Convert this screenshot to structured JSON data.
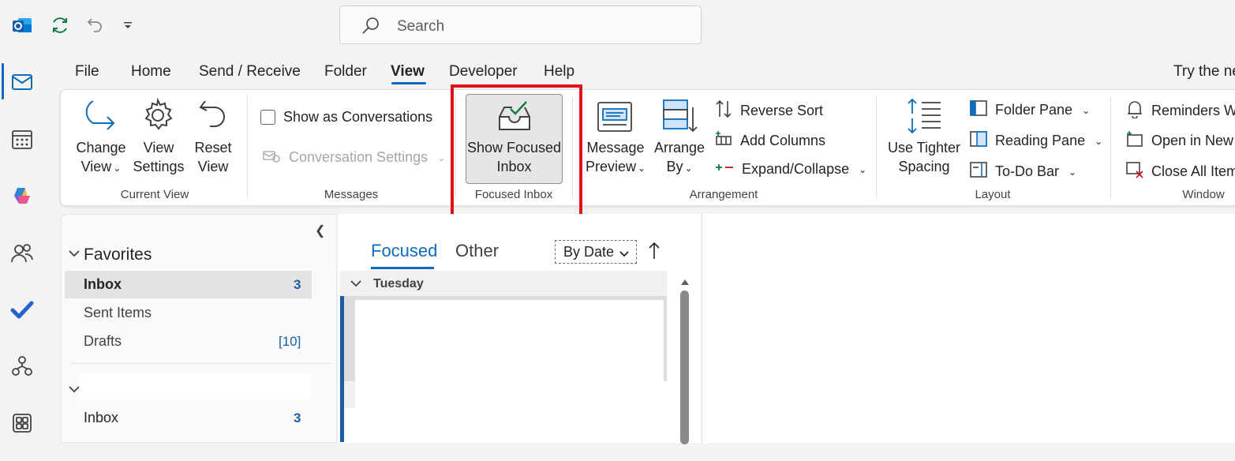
{
  "search": {
    "placeholder": "Search"
  },
  "menu": {
    "tabs": [
      "File",
      "Home",
      "Send / Receive",
      "Folder",
      "View",
      "Developer",
      "Help"
    ],
    "active_tab": "View",
    "promo": "Try the ne"
  },
  "ribbon": {
    "current_view": {
      "group_label": "Current View",
      "change_view": [
        "Change",
        "View"
      ],
      "view_settings": [
        "View",
        "Settings"
      ],
      "reset_view": [
        "Reset",
        "View"
      ]
    },
    "messages": {
      "group_label": "Messages",
      "show_as_conversations": "Show as Conversations",
      "conversation_settings": "Conversation Settings"
    },
    "focused_inbox": {
      "group_label": "Focused Inbox",
      "show_focused_inbox": [
        "Show Focused",
        "Inbox"
      ]
    },
    "arrangement": {
      "group_label": "Arrangement",
      "message_preview": [
        "Message",
        "Preview"
      ],
      "arrange_by": [
        "Arrange",
        "By"
      ],
      "reverse_sort": "Reverse Sort",
      "add_columns": "Add Columns",
      "expand_collapse": "Expand/Collapse"
    },
    "layout": {
      "group_label": "Layout",
      "use_tighter_spacing": [
        "Use Tighter",
        "Spacing"
      ],
      "folder_pane": "Folder Pane",
      "reading_pane": "Reading Pane",
      "todo_bar": "To-Do Bar"
    },
    "window": {
      "group_label": "Window",
      "reminders": "Reminders Wi",
      "open_in_new": "Open in New W",
      "close_all_items": "Close All Item"
    }
  },
  "folders": {
    "favorites_label": "Favorites",
    "favorites": [
      {
        "name": "Inbox",
        "count": "3"
      },
      {
        "name": "Sent Items",
        "count": ""
      },
      {
        "name": "Drafts",
        "count": "[10]"
      }
    ],
    "account_inbox": {
      "name": "Inbox",
      "count": "3"
    }
  },
  "message_list": {
    "tabs": [
      "Focused",
      "Other"
    ],
    "sort": "By Date",
    "day_group": "Tuesday"
  },
  "colors": {
    "accent": "#0f6cbd",
    "highlight": "#e3101a",
    "count": "#1a5da8"
  }
}
